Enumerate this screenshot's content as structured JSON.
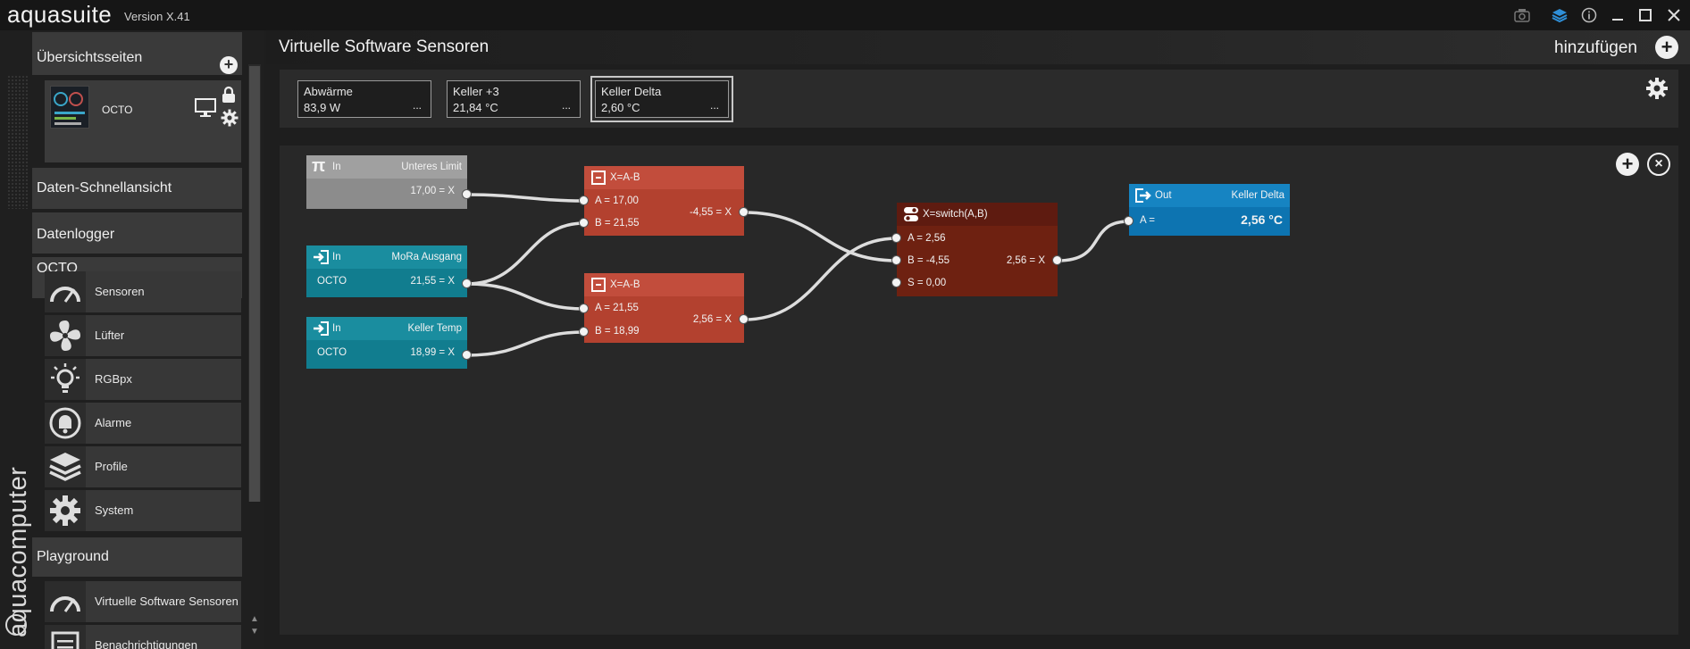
{
  "app": {
    "name": "aquasuite",
    "version": "Version X.41",
    "brand_vertical": "aquacomputer"
  },
  "sidebar": {
    "overview_title": "Übersichtsseiten",
    "overview_item": "OCTO",
    "quick_view": "Daten-Schnellansicht",
    "datalogger": "Datenlogger",
    "device_title": "OCTO",
    "device_items": [
      {
        "label": "Sensoren",
        "icon": "gauge-icon"
      },
      {
        "label": "Lüfter",
        "icon": "fan-icon"
      },
      {
        "label": "RGBpx",
        "icon": "bulb-icon"
      },
      {
        "label": "Alarme",
        "icon": "bell-icon"
      },
      {
        "label": "Profile",
        "icon": "layers-icon"
      },
      {
        "label": "System",
        "icon": "gear-icon"
      }
    ],
    "playground_title": "Playground",
    "playground_items": [
      {
        "label": "Virtuelle Software Sensoren",
        "icon": "gauge-icon"
      },
      {
        "label": "Benachrichtigungen",
        "icon": "notes-icon"
      }
    ]
  },
  "header": {
    "title": "Virtuelle Software Sensoren",
    "add_label": "hinzufügen"
  },
  "sensors": [
    {
      "name": "Abwärme",
      "value": "83,9 W",
      "more": "..."
    },
    {
      "name": "Keller +3",
      "value": "21,84 °C",
      "more": "..."
    },
    {
      "name": "Keller Delta",
      "value": "2,60 °C",
      "more": "...",
      "selected": true
    }
  ],
  "nodes": {
    "limit": {
      "icon_text": "π",
      "type": "In",
      "name": "Unteres Limit",
      "row": "17,00 = X"
    },
    "mora": {
      "type": "In",
      "name": "MoRa Ausgang",
      "source": "OCTO",
      "row": "21,55 = X"
    },
    "keller_temp": {
      "type": "In",
      "name": "Keller Temp",
      "source": "OCTO",
      "row": "18,99 = X"
    },
    "sub1": {
      "title": "X=A-B",
      "a": "A = 17,00",
      "b": "B = 21,55",
      "out": "-4,55 = X"
    },
    "sub2": {
      "title": "X=A-B",
      "a": "A = 21,55",
      "b": "B = 18,99",
      "out": "2,56 = X"
    },
    "switch": {
      "title": "X=switch(A,B)",
      "a": "A = 2,56",
      "b": "B = -4,55",
      "s": "S = 0,00",
      "out": "2,56 = X"
    },
    "out": {
      "type": "Out",
      "name": "Keller Delta",
      "a": "A =",
      "value": "2,56 °C"
    }
  },
  "colors": {
    "const_node": "#8c8c8c",
    "input_node": "#117d8f",
    "op_node": "#b3412f",
    "switch_node": "#6e2111",
    "output_node": "#0d74b1"
  }
}
